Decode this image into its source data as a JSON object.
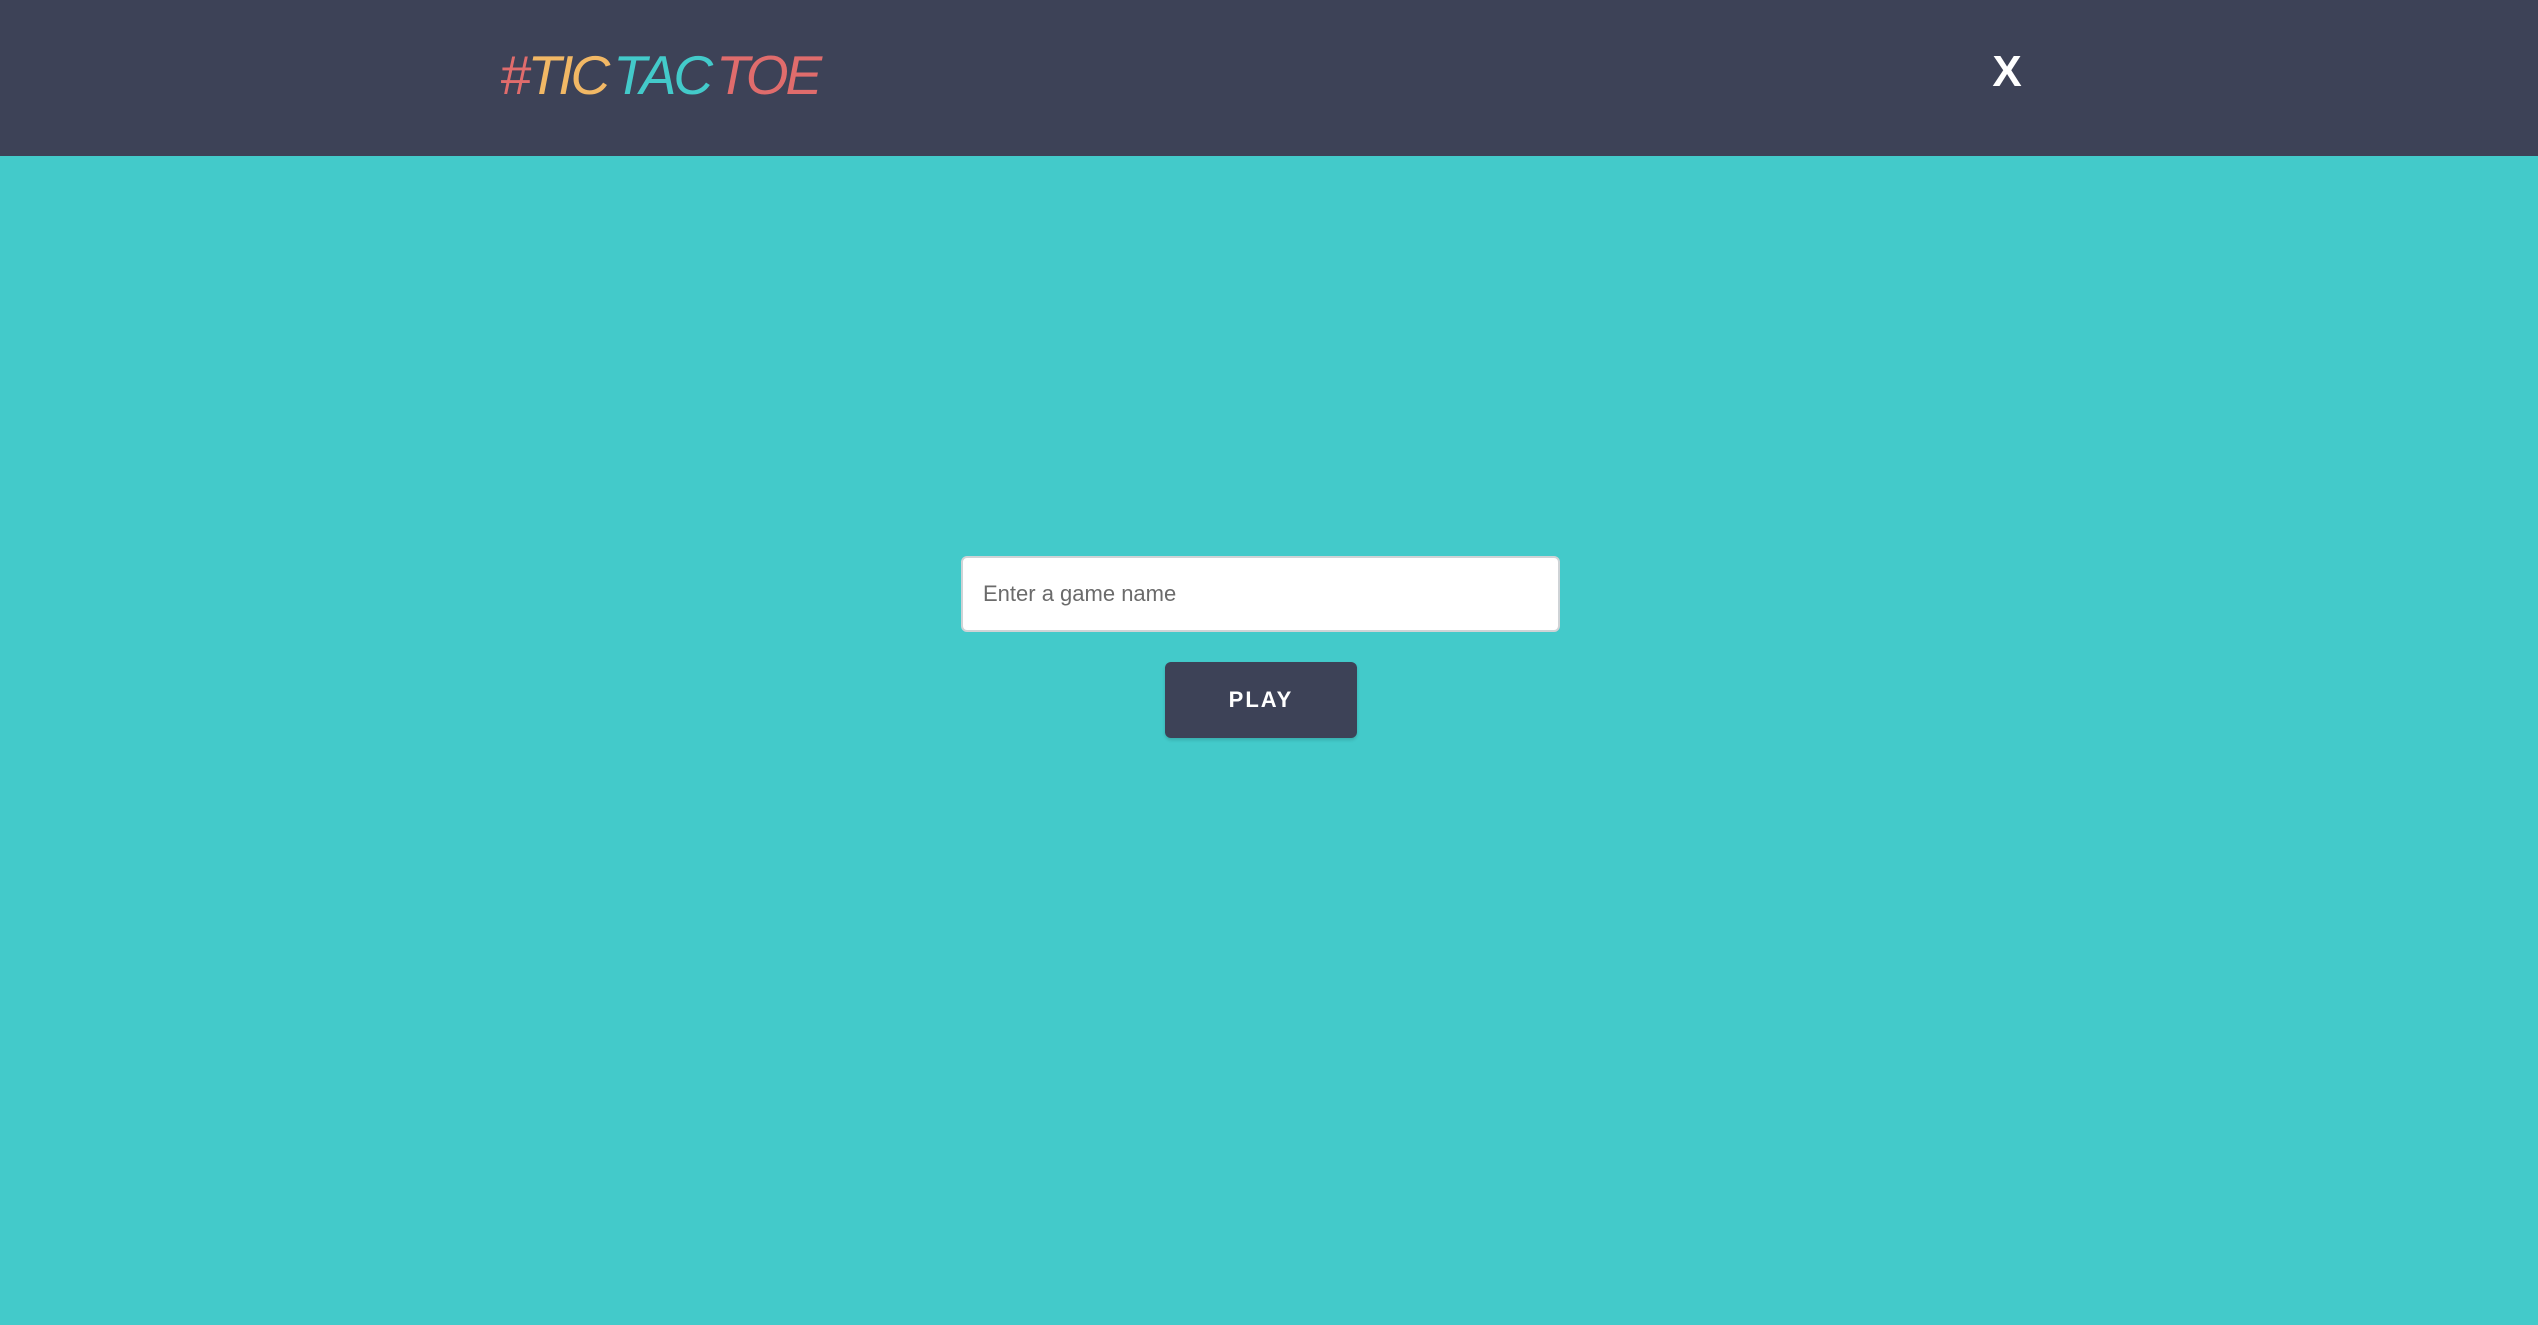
{
  "header": {
    "logo": {
      "hash": "#",
      "tic": "TIC",
      "tac": "TAC",
      "toe": "TOE"
    },
    "close_label": "X"
  },
  "form": {
    "game_name_placeholder": "Enter a game name",
    "game_name_value": "",
    "play_label": "PLAY"
  },
  "colors": {
    "background": "#43caca",
    "header": "#3d4257",
    "accent_red": "#e06c6c",
    "accent_yellow": "#f2b865",
    "accent_teal": "#43caca",
    "button": "#3d4257"
  }
}
